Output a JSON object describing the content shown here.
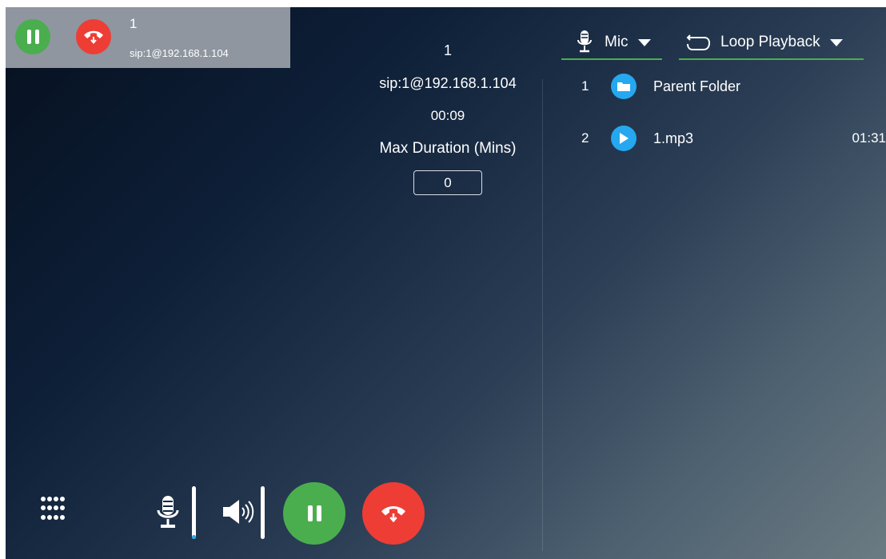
{
  "call_card": {
    "name": "1",
    "uri": "sip:1@192.168.1.104"
  },
  "call_info": {
    "name": "1",
    "uri": "sip:1@192.168.1.104",
    "elapsed": "00:09",
    "max_duration_label": "Max Duration (Mins)",
    "max_duration_value": "0"
  },
  "source_dropdown": {
    "label": "Mic",
    "icon": "microphone-icon"
  },
  "mode_dropdown": {
    "label": "Loop Playback",
    "icon": "loop-icon"
  },
  "files": [
    {
      "index": "1",
      "name": "Parent Folder",
      "icon": "folder-icon",
      "duration": ""
    },
    {
      "index": "2",
      "name": "1.mp3",
      "icon": "play-icon",
      "duration": "01:31"
    }
  ],
  "mic_level": 0.05,
  "colors": {
    "accent_green": "#4aae4e",
    "hangup_red": "#ee3d35",
    "file_blue": "#25a8ef"
  }
}
